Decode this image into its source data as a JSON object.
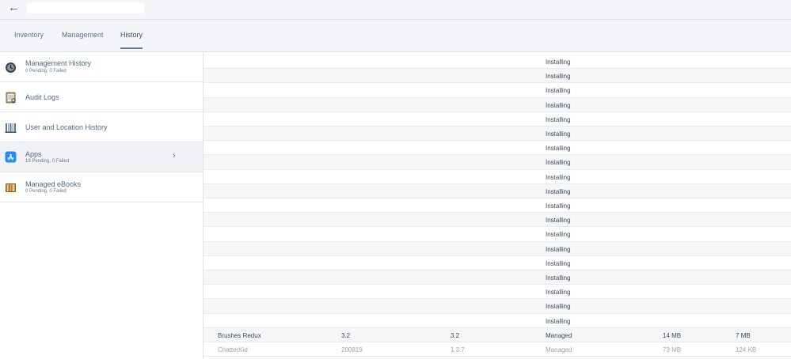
{
  "header": {
    "back_icon": "arrow-left-icon",
    "back_glyph": "←"
  },
  "tabs": [
    {
      "label": "Inventory"
    },
    {
      "label": "Management"
    },
    {
      "label": "History",
      "active": true
    }
  ],
  "sidebar": {
    "items": [
      {
        "title": "Management History",
        "subtitle": "0 Pending, 0 Failed",
        "icon": "management-history-icon"
      },
      {
        "title": "Audit Logs",
        "subtitle": "",
        "icon": "audit-logs-icon"
      },
      {
        "title": "User and Location History",
        "subtitle": "",
        "icon": "user-location-history-icon"
      },
      {
        "title": "Apps",
        "subtitle": "19 Pending, 0 Failed",
        "icon": "app-store-icon",
        "selected": true,
        "chevron": "›"
      },
      {
        "title": "Managed eBooks",
        "subtitle": "0 Pending, 0 Failed",
        "icon": "books-icon"
      }
    ]
  },
  "table": {
    "rows": [
      {
        "name": "",
        "version": "",
        "short_version": "",
        "status": "Installing",
        "size": "",
        "dynamic_size": ""
      },
      {
        "name": "",
        "version": "",
        "short_version": "",
        "status": "Installing",
        "size": "",
        "dynamic_size": ""
      },
      {
        "name": "",
        "version": "",
        "short_version": "",
        "status": "Installing",
        "size": "",
        "dynamic_size": ""
      },
      {
        "name": "",
        "version": "",
        "short_version": "",
        "status": "Installing",
        "size": "",
        "dynamic_size": ""
      },
      {
        "name": "",
        "version": "",
        "short_version": "",
        "status": "Installing",
        "size": "",
        "dynamic_size": ""
      },
      {
        "name": "",
        "version": "",
        "short_version": "",
        "status": "Installing",
        "size": "",
        "dynamic_size": ""
      },
      {
        "name": "",
        "version": "",
        "short_version": "",
        "status": "Installing",
        "size": "",
        "dynamic_size": ""
      },
      {
        "name": "",
        "version": "",
        "short_version": "",
        "status": "Installing",
        "size": "",
        "dynamic_size": ""
      },
      {
        "name": "",
        "version": "",
        "short_version": "",
        "status": "Installing",
        "size": "",
        "dynamic_size": ""
      },
      {
        "name": "",
        "version": "",
        "short_version": "",
        "status": "Installing",
        "size": "",
        "dynamic_size": ""
      },
      {
        "name": "",
        "version": "",
        "short_version": "",
        "status": "Installing",
        "size": "",
        "dynamic_size": ""
      },
      {
        "name": "",
        "version": "",
        "short_version": "",
        "status": "Installing",
        "size": "",
        "dynamic_size": ""
      },
      {
        "name": "",
        "version": "",
        "short_version": "",
        "status": "Installing",
        "size": "",
        "dynamic_size": ""
      },
      {
        "name": "",
        "version": "",
        "short_version": "",
        "status": "Installing",
        "size": "",
        "dynamic_size": ""
      },
      {
        "name": "",
        "version": "",
        "short_version": "",
        "status": "Installing",
        "size": "",
        "dynamic_size": ""
      },
      {
        "name": "",
        "version": "",
        "short_version": "",
        "status": "Installing",
        "size": "",
        "dynamic_size": ""
      },
      {
        "name": "",
        "version": "",
        "short_version": "",
        "status": "Installing",
        "size": "",
        "dynamic_size": ""
      },
      {
        "name": "",
        "version": "",
        "short_version": "",
        "status": "Installing",
        "size": "",
        "dynamic_size": ""
      },
      {
        "name": "",
        "version": "",
        "short_version": "",
        "status": "Installing",
        "size": "",
        "dynamic_size": ""
      },
      {
        "name": "Brushes Redux",
        "version": "3.2",
        "short_version": "3.2",
        "status": "Managed",
        "size": "14 MB",
        "dynamic_size": "7 MB"
      },
      {
        "name": "ChatterKid",
        "version": "200819",
        "short_version": "1.3.7",
        "status": "Managed",
        "size": "73 MB",
        "dynamic_size": "124 KB"
      }
    ]
  }
}
